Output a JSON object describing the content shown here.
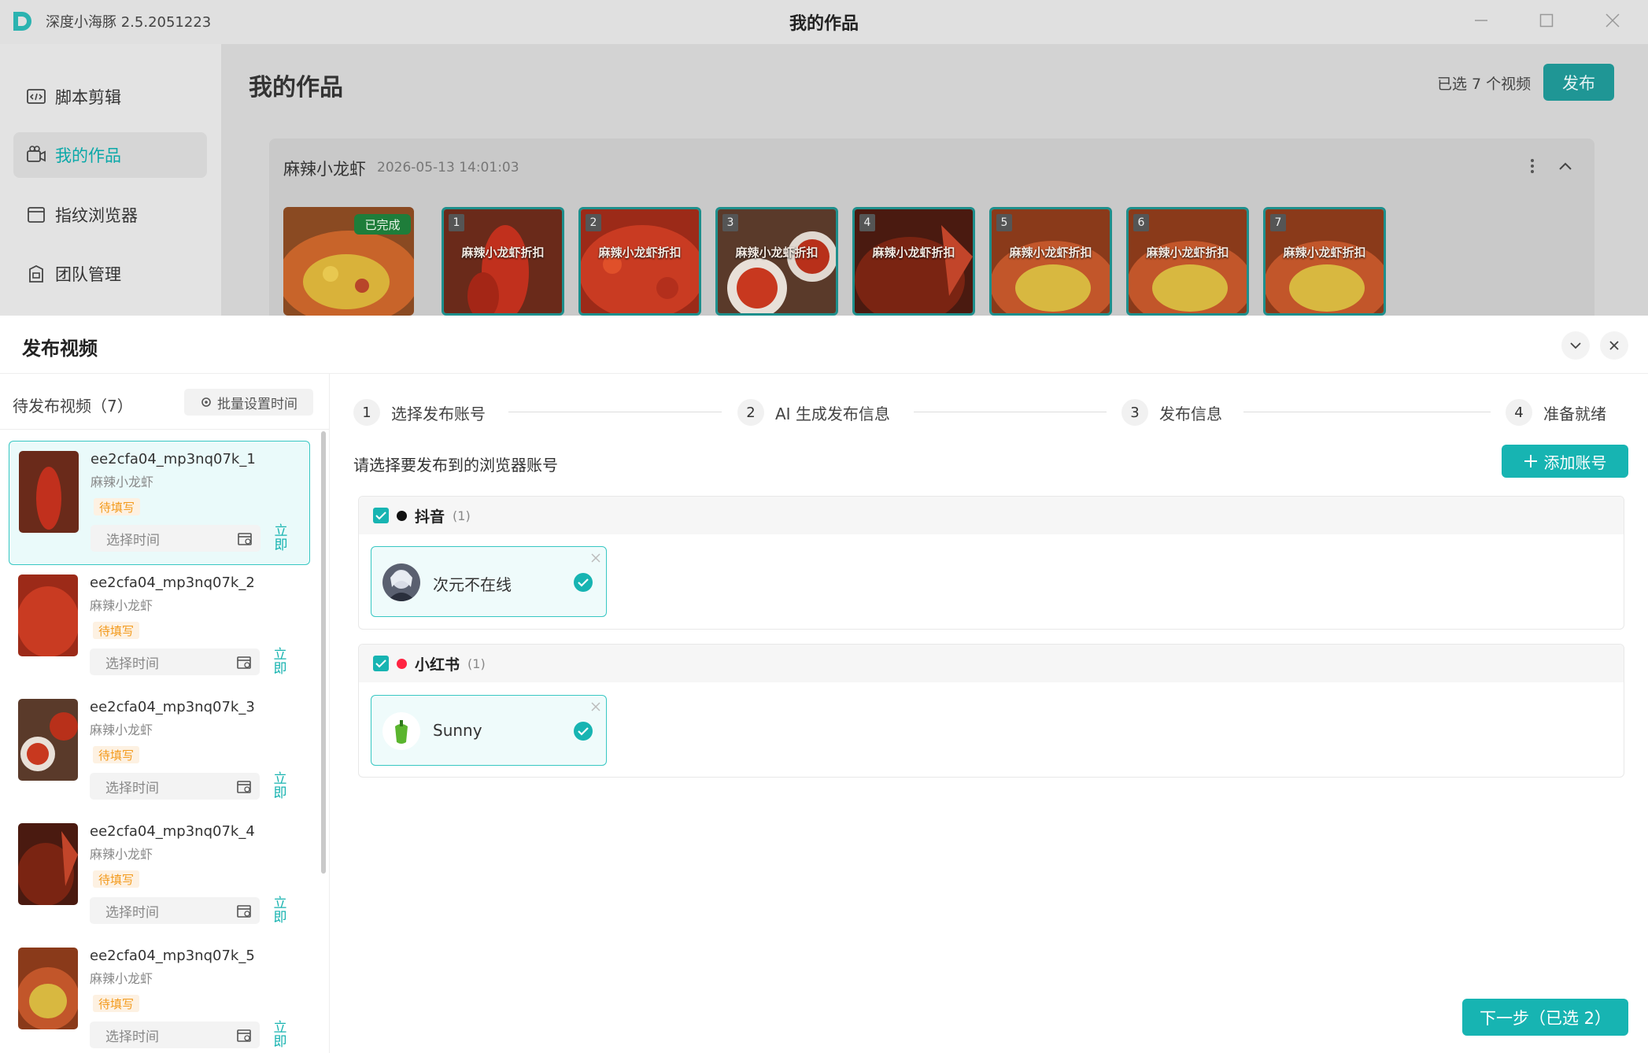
{
  "window": {
    "app_version": "深度小海豚 2.5.2051223",
    "title": "我的作品"
  },
  "sidebar": {
    "items": [
      {
        "label": "脚本剪辑",
        "icon": "code-icon",
        "active": false
      },
      {
        "label": "我的作品",
        "icon": "camera-icon",
        "active": true
      },
      {
        "label": "指纹浏览器",
        "icon": "browser-icon",
        "active": false
      },
      {
        "label": "团队管理",
        "icon": "team-icon",
        "active": false
      }
    ]
  },
  "main": {
    "title": "我的作品",
    "selected_count": "已选 7 个视频",
    "publish_label": "发布"
  },
  "project": {
    "name": "麻辣小龙虾",
    "time": "2026-05-13 14:01:03",
    "done_badge": "已完成",
    "thumbs": [
      {
        "index": "1",
        "caption": "麻辣小龙虾折扣"
      },
      {
        "index": "2",
        "caption": "麻辣小龙虾折扣"
      },
      {
        "index": "3",
        "caption": "麻辣小龙虾折扣"
      },
      {
        "index": "4",
        "caption": "麻辣小龙虾折扣"
      },
      {
        "index": "5",
        "caption": "麻辣小龙虾折扣"
      },
      {
        "index": "6",
        "caption": "麻辣小龙虾折扣"
      },
      {
        "index": "7",
        "caption": "麻辣小龙虾折扣"
      }
    ]
  },
  "panel": {
    "title": "发布视频",
    "pending_title": "待发布视频（7）",
    "batch_label": "批量设置时间",
    "videos": [
      {
        "name": "ee2cfa04_mp3nq07k_1",
        "project": "麻辣小龙虾",
        "status": "待填写",
        "time_placeholder": "选择时间",
        "now_label": "立即"
      },
      {
        "name": "ee2cfa04_mp3nq07k_2",
        "project": "麻辣小龙虾",
        "status": "待填写",
        "time_placeholder": "选择时间",
        "now_label": "立即"
      },
      {
        "name": "ee2cfa04_mp3nq07k_3",
        "project": "麻辣小龙虾",
        "status": "待填写",
        "time_placeholder": "选择时间",
        "now_label": "立即"
      },
      {
        "name": "ee2cfa04_mp3nq07k_4",
        "project": "麻辣小龙虾",
        "status": "待填写",
        "time_placeholder": "选择时间",
        "now_label": "立即"
      },
      {
        "name": "ee2cfa04_mp3nq07k_5",
        "project": "麻辣小龙虾",
        "status": "待填写",
        "time_placeholder": "选择时间",
        "now_label": "立即"
      }
    ],
    "steps": [
      {
        "num": "1",
        "label": "选择发布账号"
      },
      {
        "num": "2",
        "label": "AI 生成发布信息"
      },
      {
        "num": "3",
        "label": "发布信息"
      },
      {
        "num": "4",
        "label": "准备就绪"
      }
    ],
    "choose_label": "请选择要发布到的浏览器账号",
    "add_account_label": "添加账号",
    "groups": [
      {
        "name": "抖音",
        "count": "(1)",
        "dot_color": "#111111",
        "account": "次元不在线"
      },
      {
        "name": "小红书",
        "count": "(1)",
        "dot_color": "#ff2442",
        "account": "Sunny"
      }
    ],
    "next_label": "下一步（已选 2）"
  },
  "colors": {
    "accent": "#17b4b2",
    "publish": "#1f9695",
    "status_pending": "#f39a1c"
  }
}
